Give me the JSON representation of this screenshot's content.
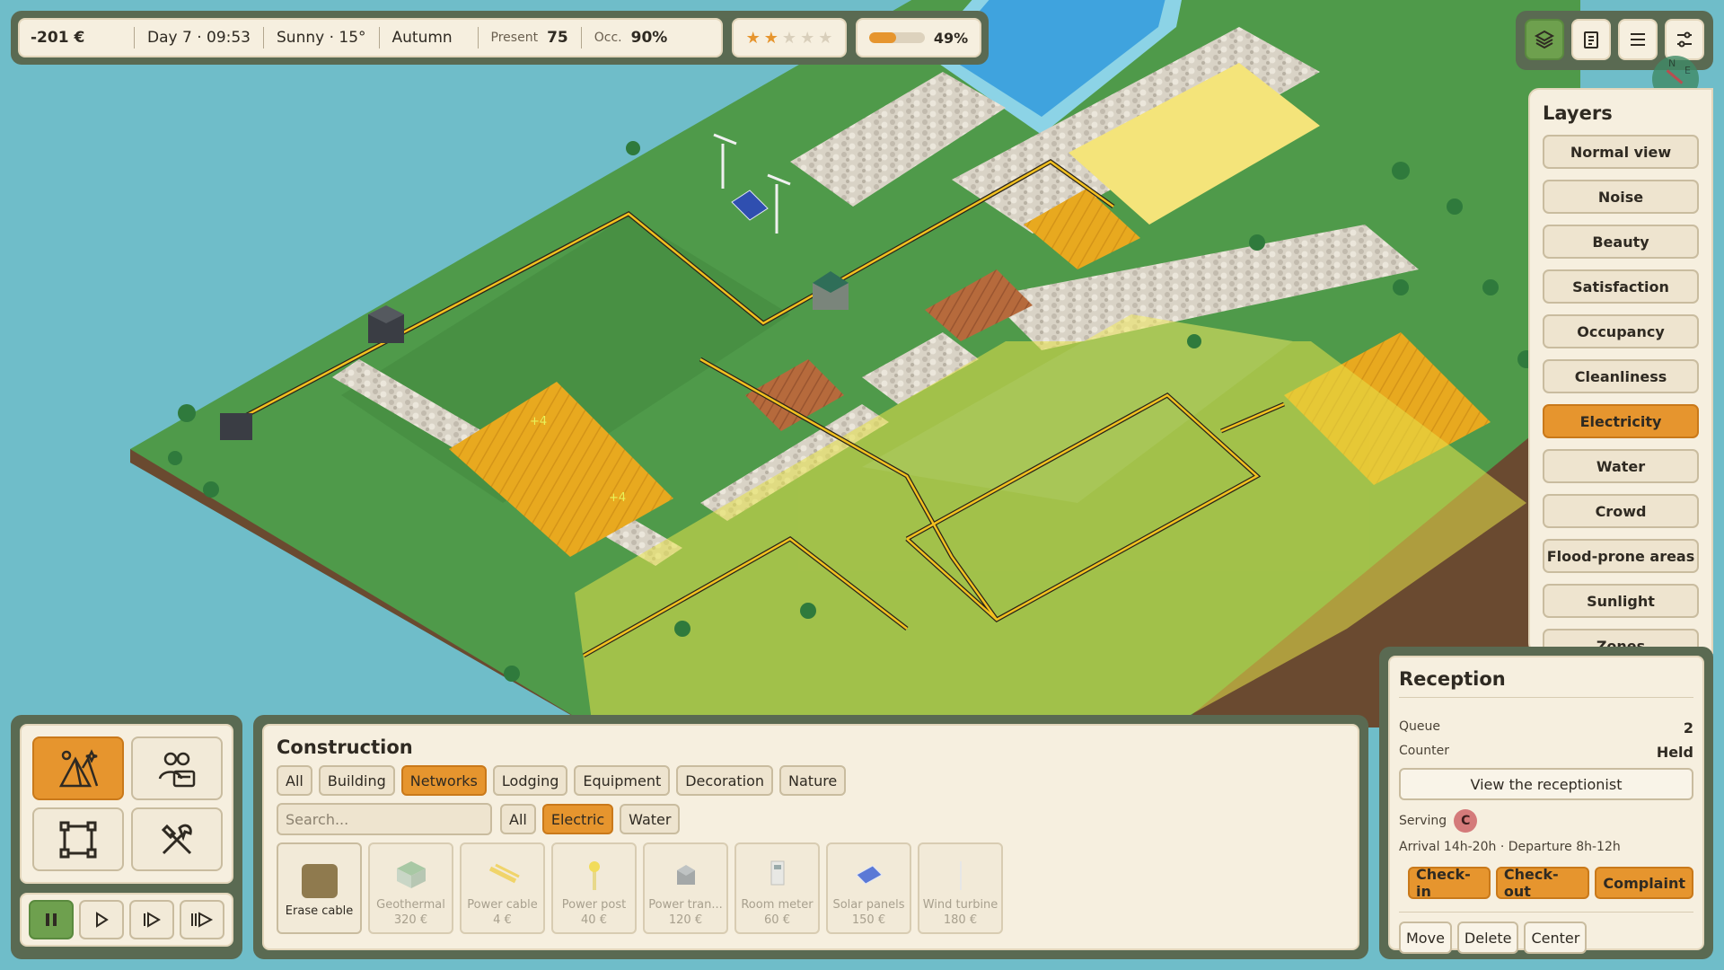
{
  "status": {
    "money": "-201 €",
    "day_time": "Day 7 · 09:53",
    "weather": "Sunny · 15°",
    "season": "Autumn",
    "present_label": "Present",
    "present_value": "75",
    "occ_label": "Occ.",
    "occ_value": "90%"
  },
  "rating": {
    "stars": 2,
    "max": 5
  },
  "progress": {
    "percent": 49,
    "label": "49%"
  },
  "world_marks": {
    "plus_a": "+4",
    "plus_b": "+4"
  },
  "top_right": {
    "buttons": [
      {
        "icon": "layers-icon",
        "active": true
      },
      {
        "icon": "clipboard-icon",
        "active": false
      },
      {
        "icon": "menu-icon",
        "active": false
      },
      {
        "icon": "settings-sliders-icon",
        "active": false
      }
    ],
    "compass_n": "N",
    "compass_e": "E"
  },
  "layers": {
    "title": "Layers",
    "items": [
      {
        "label": "Normal view",
        "active": false
      },
      {
        "label": "Noise",
        "active": false
      },
      {
        "label": "Beauty",
        "active": false
      },
      {
        "label": "Satisfaction",
        "active": false
      },
      {
        "label": "Occupancy",
        "active": false
      },
      {
        "label": "Cleanliness",
        "active": false
      },
      {
        "label": "Electricity",
        "active": true
      },
      {
        "label": "Water",
        "active": false
      },
      {
        "label": "Crowd",
        "active": false
      },
      {
        "label": "Flood-prone areas",
        "active": false
      },
      {
        "label": "Sunlight",
        "active": false
      },
      {
        "label": "Zones",
        "active": false
      }
    ]
  },
  "modes": [
    {
      "icon": "campsite-tent-icon",
      "active": true
    },
    {
      "icon": "staff-icon",
      "active": false
    },
    {
      "icon": "zone-select-icon",
      "active": false
    },
    {
      "icon": "tools-icon",
      "active": false
    }
  ],
  "speed": [
    {
      "icon": "pause-icon",
      "active": true
    },
    {
      "icon": "play-icon",
      "active": false
    },
    {
      "icon": "fast-forward-icon",
      "active": false
    },
    {
      "icon": "fastest-forward-icon",
      "active": false
    }
  ],
  "construction": {
    "title": "Construction",
    "tabs": [
      {
        "label": "All",
        "active": false
      },
      {
        "label": "Building",
        "active": false
      },
      {
        "label": "Networks",
        "active": true
      },
      {
        "label": "Lodging",
        "active": false
      },
      {
        "label": "Equipment",
        "active": false
      },
      {
        "label": "Decoration",
        "active": false
      },
      {
        "label": "Nature",
        "active": false
      }
    ],
    "search_placeholder": "Search...",
    "subtabs": [
      {
        "label": "All",
        "active": false
      },
      {
        "label": "Electric",
        "active": true
      },
      {
        "label": "Water",
        "active": false
      }
    ],
    "items": [
      {
        "name": "Erase cable",
        "price": "",
        "icon": "erase-cable-icon",
        "enabled": true
      },
      {
        "name": "Geothermal",
        "price": "320 €",
        "icon": "geothermal-icon",
        "enabled": false
      },
      {
        "name": "Power cable",
        "price": "4 €",
        "icon": "power-cable-icon",
        "enabled": false
      },
      {
        "name": "Power post",
        "price": "40 €",
        "icon": "power-post-icon",
        "enabled": false
      },
      {
        "name": "Power tran...",
        "price": "120 €",
        "icon": "power-transformer-icon",
        "enabled": false
      },
      {
        "name": "Room meter",
        "price": "60 €",
        "icon": "room-meter-icon",
        "enabled": false
      },
      {
        "name": "Solar panels",
        "price": "150 €",
        "icon": "solar-panel-icon",
        "enabled": false
      },
      {
        "name": "Wind turbine",
        "price": "180 €",
        "icon": "wind-turbine-icon",
        "enabled": false
      }
    ]
  },
  "reception": {
    "title": "Reception",
    "queue_label": "Queue",
    "queue_value": "2",
    "counter_label": "Counter",
    "counter_value": "Held",
    "view_button": "View the receptionist",
    "serving_label": "Serving",
    "serving_badge": "C",
    "times": "Arrival 14h-20h · Departure 8h-12h",
    "actions": [
      "Check-in",
      "Check-out",
      "Complaint"
    ],
    "secondary": [
      "Move",
      "Delete",
      "Center"
    ]
  },
  "colors": {
    "accent": "#e6952e",
    "active_green": "#6ea04e",
    "panel": "#f6efdf",
    "water": "#6fbdc9",
    "grass": "#4f9a4a",
    "cable": "#f2c020"
  }
}
